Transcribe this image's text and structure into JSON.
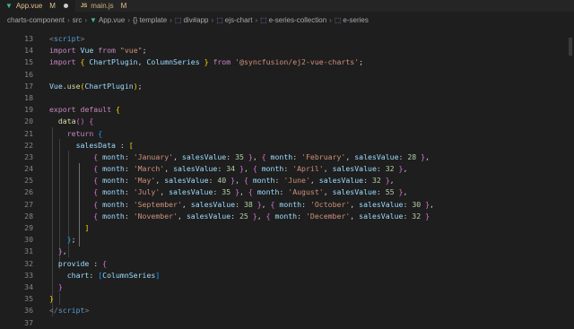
{
  "tabs": [
    {
      "label": "App.vue",
      "status": "M",
      "active": true
    },
    {
      "label": "main.js",
      "status": "M",
      "active": false
    }
  ],
  "breadcrumb": [
    "charts-component",
    "src",
    "App.vue",
    "{} template",
    "div#app",
    "ejs-chart",
    "e-series-collection",
    "e-series"
  ],
  "editor": {
    "line_numbers": [
      "13",
      "14",
      "15",
      "16",
      "17",
      "18",
      "19",
      "20",
      "21",
      "22",
      "23",
      "24",
      "25",
      "26",
      "27",
      "28",
      "29",
      "30",
      "31",
      "32",
      "33",
      "34",
      "35",
      "36",
      "37"
    ]
  },
  "colors": {
    "background": "#1e1e1e",
    "keyword": "#c586c0",
    "string": "#ce9178",
    "number": "#b5cea8",
    "vue_green": "#41b883"
  }
}
